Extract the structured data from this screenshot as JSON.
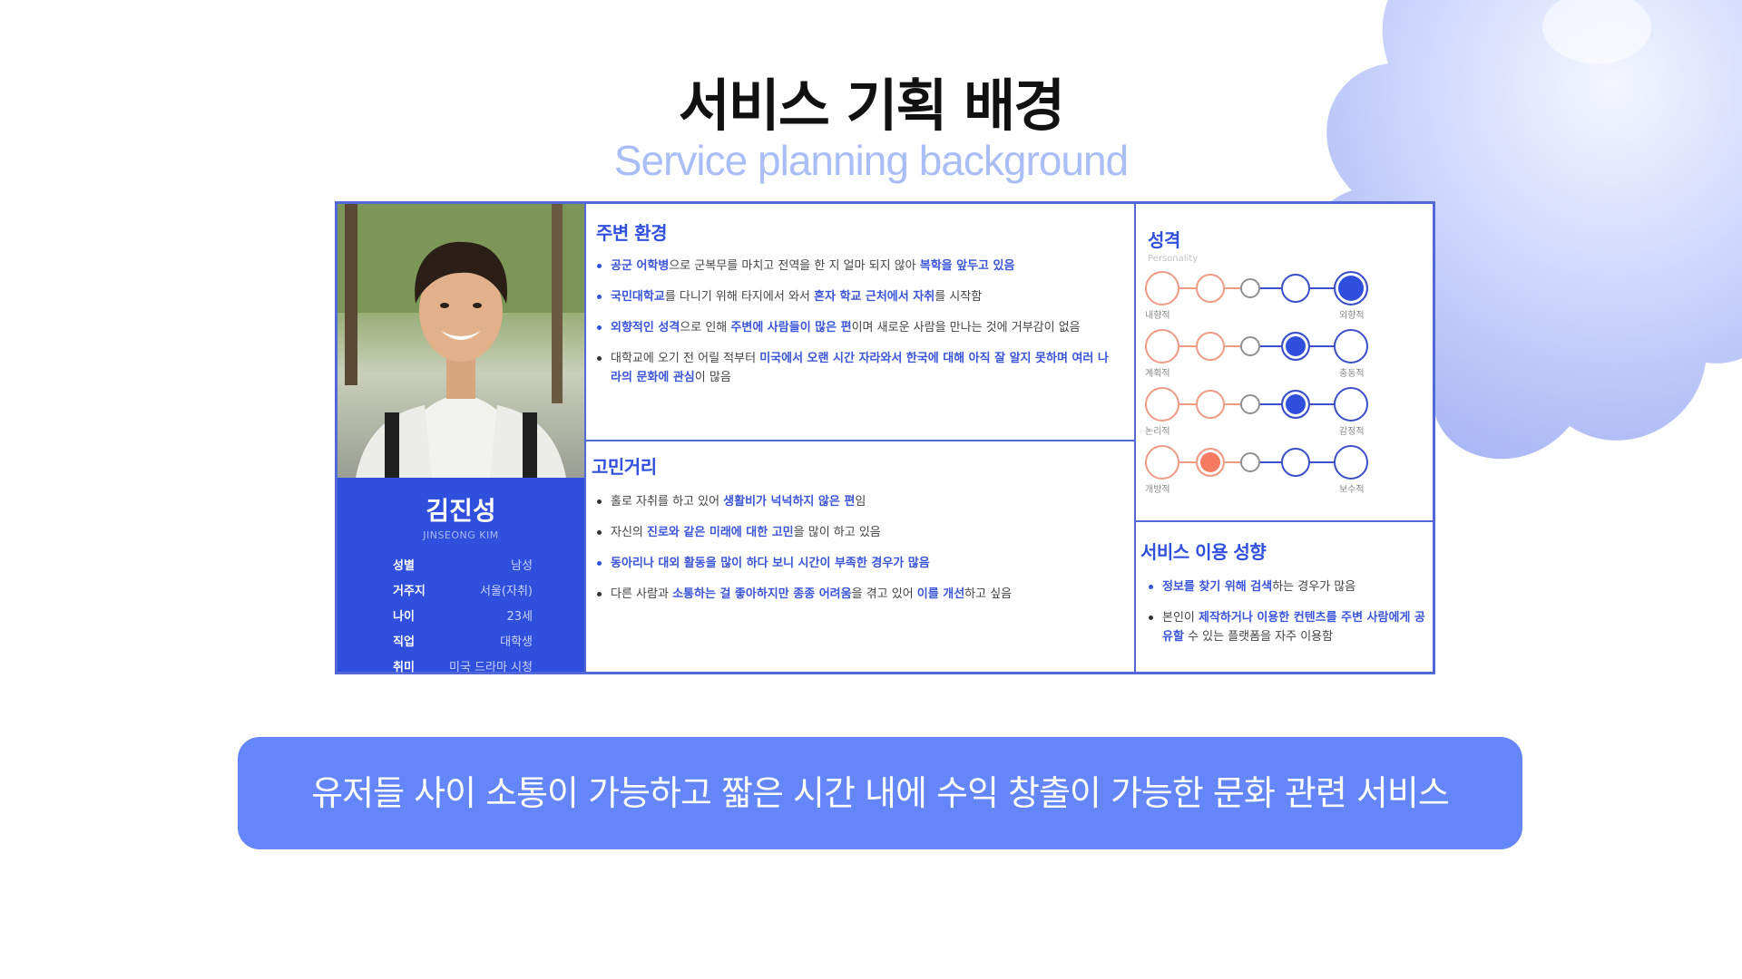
{
  "colors": {
    "accent": "#2f4fdc",
    "banner_bg": "#6486f9",
    "subtitle": "#a9bdf7",
    "scale_orange": "#ef9b85"
  },
  "header": {
    "title": "서비스 기획 배경",
    "subtitle": "Service planning background"
  },
  "profile": {
    "name": "김진성",
    "name_en": "JINSEONG KIM",
    "rows": [
      {
        "key": "성별",
        "value": "남성"
      },
      {
        "key": "거주지",
        "value": "서울(자취)"
      },
      {
        "key": "나이",
        "value": "23세"
      },
      {
        "key": "직업",
        "value": "대학생"
      },
      {
        "key": "취미",
        "value": "미국 드라마 시청"
      }
    ]
  },
  "environment": {
    "title": "주변 환경",
    "items": [
      {
        "parts": [
          {
            "t": "공군 어학병",
            "h": true
          },
          {
            "t": "으로 군복무를 마치고 전역을 한 지 얼마 되지 않아 "
          },
          {
            "t": "복학을 앞두고 있음",
            "h": true
          }
        ],
        "blue": true
      },
      {
        "parts": [
          {
            "t": "국민대학교",
            "h": true
          },
          {
            "t": "를 다니기 위해 타지에서 와서 "
          },
          {
            "t": "혼자 학교 근처에서 자취",
            "h": true
          },
          {
            "t": "를 시작함"
          }
        ],
        "blue": true
      },
      {
        "parts": [
          {
            "t": "외향적인 성격",
            "h": true
          },
          {
            "t": "으로 인해 "
          },
          {
            "t": "주변에 사람들이 많은 편",
            "h": true
          },
          {
            "t": "이며 새로운 사람을 만나는 것에 거부감이 없음"
          }
        ],
        "blue": true
      },
      {
        "parts": [
          {
            "t": "대학교에 오기 전 어릴 적부터 "
          },
          {
            "t": "미국에서 오랜 시간 자라와서 한국에 대해 아직 잘 알지 못하며 여러 나라의 문화에 관심",
            "h": true
          },
          {
            "t": "이 많음"
          }
        ],
        "blue": false
      }
    ]
  },
  "concerns": {
    "title": "고민거리",
    "items": [
      {
        "parts": [
          {
            "t": "홀로 자취를 하고 있어 "
          },
          {
            "t": "생활비가 넉넉하지 않은 편",
            "h": true
          },
          {
            "t": "임"
          }
        ],
        "blue": false
      },
      {
        "parts": [
          {
            "t": "자신의 "
          },
          {
            "t": "진로와 같은 미래에 대한 고민",
            "h": true
          },
          {
            "t": "을 많이 하고 있음"
          }
        ],
        "blue": false
      },
      {
        "parts": [
          {
            "t": "동아리나 대외 활동을 많이 하다 보니 시간이 부족한 경우가 많음",
            "h": true
          }
        ],
        "blue": true
      },
      {
        "parts": [
          {
            "t": "다른 사람과 "
          },
          {
            "t": "소통하는 걸 좋아하지만 종종 어려움",
            "h": true
          },
          {
            "t": "을 겪고 있어 "
          },
          {
            "t": "이를 개선",
            "h": true
          },
          {
            "t": "하고 싶음"
          }
        ],
        "blue": false
      }
    ]
  },
  "personality": {
    "title": "성격",
    "subtitle": "Personality",
    "scales": [
      {
        "left": "내향적",
        "right": "외향적",
        "selected": 5
      },
      {
        "left": "계획적",
        "right": "충동적",
        "selected": 4
      },
      {
        "left": "논리적",
        "right": "감정적",
        "selected": 4
      },
      {
        "left": "개방적",
        "right": "보수적",
        "selected": 2
      }
    ]
  },
  "service_usage": {
    "title": "서비스 이용 성향",
    "items": [
      {
        "parts": [
          {
            "t": "정보를 찾기 위해 검색",
            "h": true
          },
          {
            "t": "하는 경우가 많음"
          }
        ],
        "blue": true
      },
      {
        "parts": [
          {
            "t": "본인이 "
          },
          {
            "t": "제작하거나 이용한 컨텐츠를 주변 사람에게 공유할",
            "h": true
          },
          {
            "t": " 수 있는 플랫폼을 자주 이용함"
          }
        ],
        "blue": false
      }
    ]
  },
  "banner": {
    "text": "유저들 사이 소통이 가능하고 짧은 시간 내에 수익 창출이 가능한 문화 관련 서비스"
  }
}
